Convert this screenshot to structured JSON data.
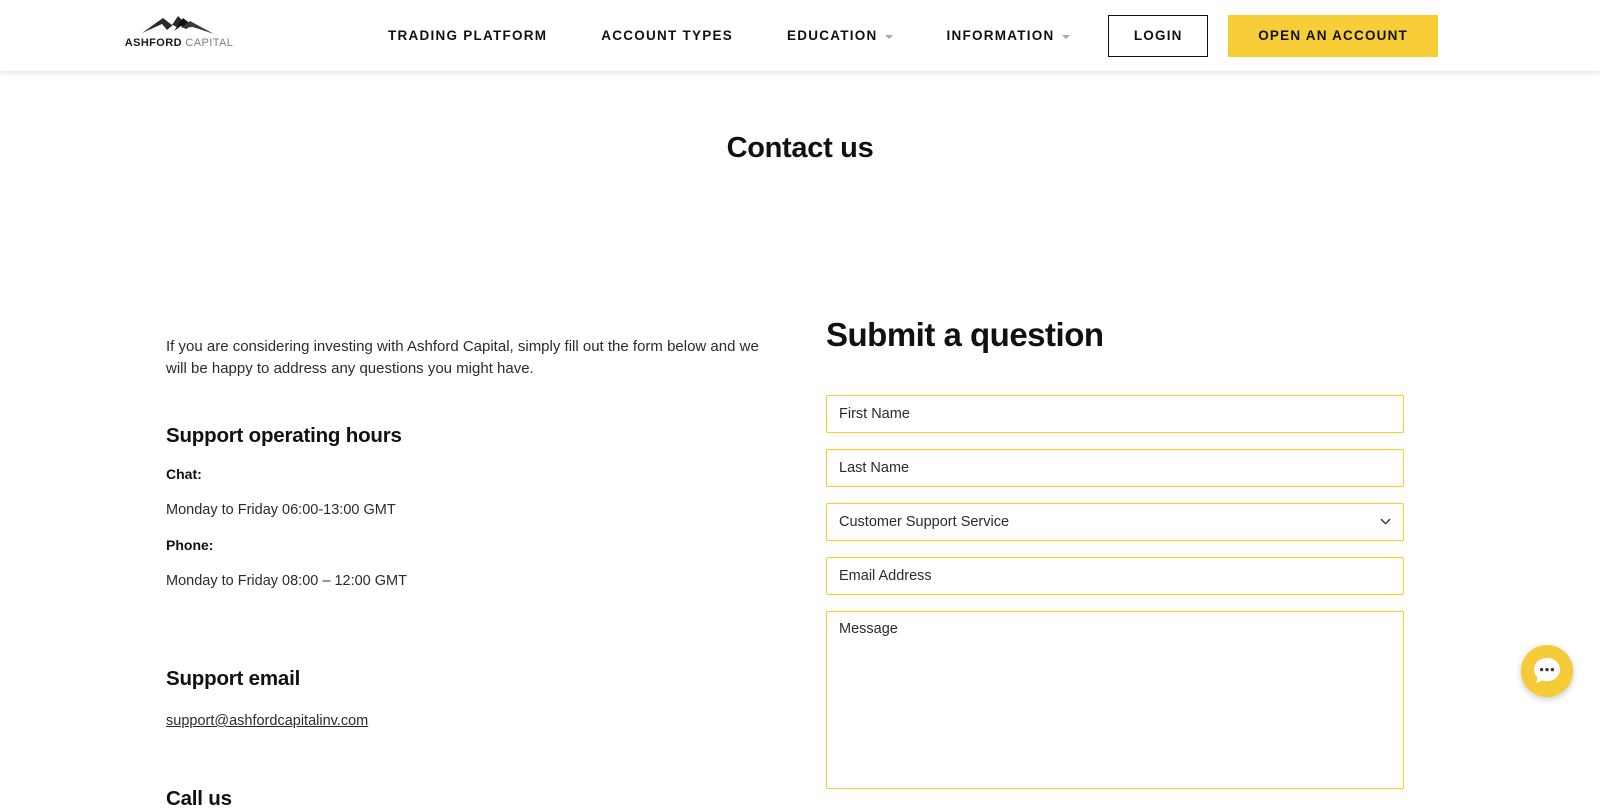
{
  "header": {
    "logo": {
      "name_bold": "ASHFORD",
      "name_light": "CAPITAL",
      "icon": "mountain-peaks-icon"
    },
    "nav": [
      {
        "label": "TRADING PLATFORM",
        "has_dropdown": false
      },
      {
        "label": "ACCOUNT TYPES",
        "has_dropdown": false
      },
      {
        "label": "EDUCATION",
        "has_dropdown": true
      },
      {
        "label": "INFORMATION",
        "has_dropdown": true
      }
    ],
    "login_label": "LOGIN",
    "open_account_label": "OPEN AN ACCOUNT",
    "accent_color": "#F7CE38"
  },
  "page": {
    "title": "Contact us"
  },
  "left": {
    "intro": "If you are considering investing with Ashford Capital, simply fill out the form below and we will be happy to address any questions you might have.",
    "support_hours_heading": "Support operating hours",
    "chat_label": "Chat:",
    "chat_hours": "Monday to Friday 06:00-13:00 GMT",
    "phone_label": "Phone:",
    "phone_hours": "Monday to Friday 08:00 – 12:00 GMT",
    "support_email_heading": "Support email",
    "support_email": "support@ashfordcapitalinv.com",
    "call_us_heading": "Call us"
  },
  "form": {
    "title": "Submit a question",
    "border_color": "#FFCC22",
    "first_name_placeholder": "First Name",
    "first_name_value": "",
    "last_name_placeholder": "Last Name",
    "last_name_value": "",
    "department_selected": "Customer Support Service",
    "department_options": [
      "Customer Support Service"
    ],
    "email_placeholder": "Email Address",
    "email_value": "",
    "message_placeholder": "Message",
    "message_value": ""
  },
  "chat_widget": {
    "label": "chat-bubble-icon",
    "color": "#F5CB38"
  }
}
